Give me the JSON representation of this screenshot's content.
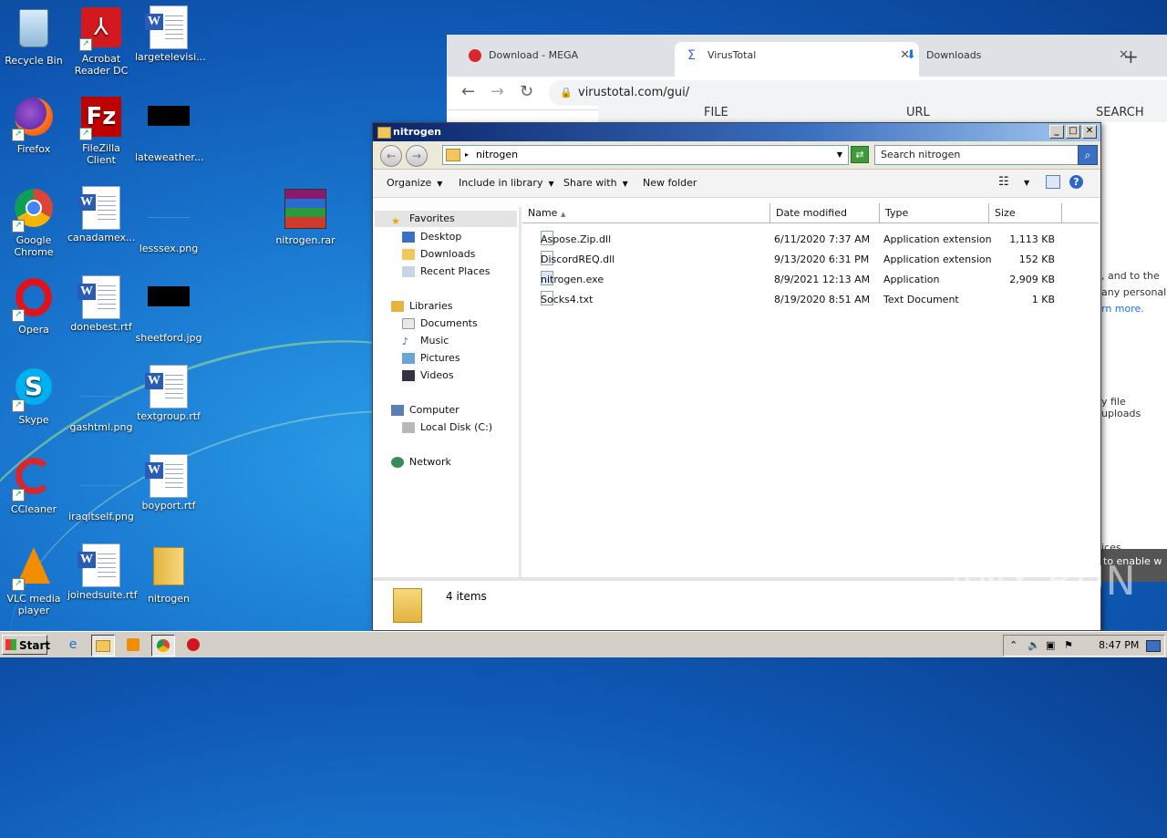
{
  "desktop": {
    "icons": [
      {
        "label": "Recycle Bin"
      },
      {
        "label": "Acrobat Reader DC"
      },
      {
        "label": "largetelevisi..."
      },
      {
        "label": "Firefox"
      },
      {
        "label": "FileZilla Client"
      },
      {
        "label": "lateweather..."
      },
      {
        "label": "Google Chrome"
      },
      {
        "label": "canadamex..."
      },
      {
        "label": "lesssex.png"
      },
      {
        "label": "nitrogen.rar"
      },
      {
        "label": "Opera"
      },
      {
        "label": "donebest.rtf"
      },
      {
        "label": "sheetford.jpg"
      },
      {
        "label": "Skype"
      },
      {
        "label": "gashtml.png"
      },
      {
        "label": "textgroup.rtf"
      },
      {
        "label": "CCleaner"
      },
      {
        "label": "iraqitself.png"
      },
      {
        "label": "boyport.rtf"
      },
      {
        "label": "VLC media player"
      },
      {
        "label": "joinedsuite.rtf"
      },
      {
        "label": "nitrogen"
      }
    ]
  },
  "browser": {
    "tabs": [
      {
        "label": "Download - MEGA"
      },
      {
        "label": "VirusTotal"
      },
      {
        "label": "Downloads"
      }
    ],
    "url": "virustotal.com/gui/",
    "vt_nav": [
      "FILE",
      "URL",
      "SEARCH"
    ],
    "side_text": [
      ", and to the",
      "any personal",
      "rn more.",
      "y file uploads",
      "ices",
      "to enable w"
    ]
  },
  "explorer": {
    "title": "nitrogen",
    "address": "nitrogen",
    "search_placeholder": "Search nitrogen",
    "commands": {
      "organize": "Organize",
      "include": "Include in library",
      "share": "Share with",
      "new_folder": "New folder"
    },
    "nav": {
      "favorites": "Favorites",
      "desktop": "Desktop",
      "downloads": "Downloads",
      "recent": "Recent Places",
      "libraries": "Libraries",
      "documents": "Documents",
      "music": "Music",
      "pictures": "Pictures",
      "videos": "Videos",
      "computer": "Computer",
      "local_disk": "Local Disk (C:)",
      "network": "Network"
    },
    "columns": {
      "name": "Name",
      "date": "Date modified",
      "type": "Type",
      "size": "Size"
    },
    "files": [
      {
        "name": "Aspose.Zip.dll",
        "date": "6/11/2020 7:37 AM",
        "type": "Application extension",
        "size": "1,113 KB"
      },
      {
        "name": "DiscordREQ.dll",
        "date": "9/13/2020 6:31 PM",
        "type": "Application extension",
        "size": "152 KB"
      },
      {
        "name": "nitrogen.exe",
        "date": "8/9/2021 12:13 AM",
        "type": "Application",
        "size": "2,909 KB"
      },
      {
        "name": "Socks4.txt",
        "date": "8/19/2020 8:51 AM",
        "type": "Text Document",
        "size": "1 KB"
      }
    ],
    "status": "4 items"
  },
  "taskbar": {
    "start_label": "Start",
    "clock": "8:47 PM"
  },
  "watermark": "ANY RUN"
}
